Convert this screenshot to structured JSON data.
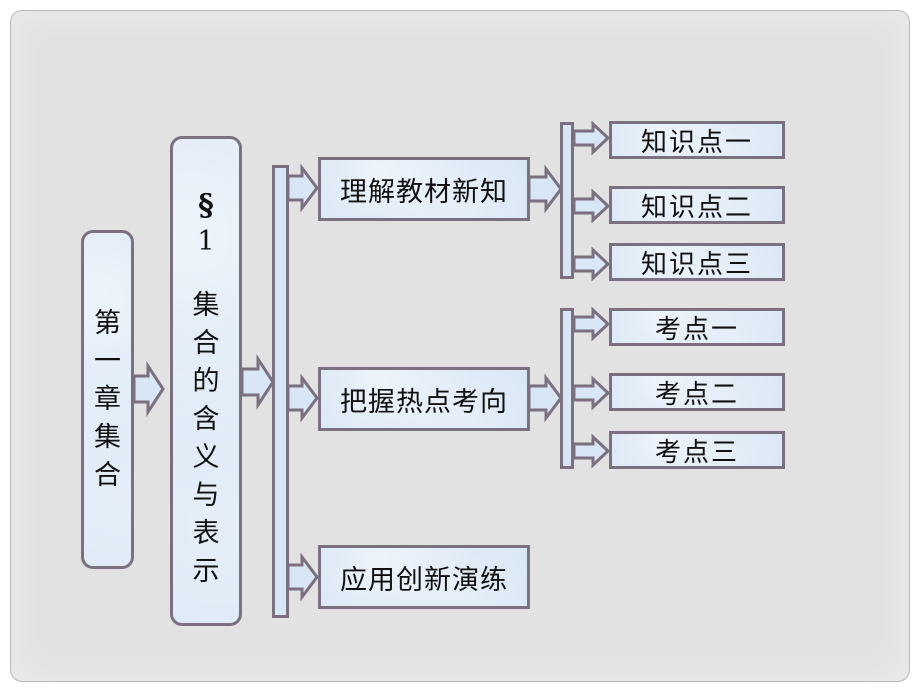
{
  "diagram": {
    "chapter": {
      "label": "第一章集合",
      "chars": [
        "第",
        "一",
        "章",
        "集",
        "合"
      ]
    },
    "section": {
      "symbol": "§",
      "number": "1",
      "title": "集合的含义与表示",
      "chars": [
        "集",
        "合",
        "的",
        "含",
        "义",
        "与",
        "表",
        "示"
      ]
    },
    "branches": [
      {
        "label": "理解教材新知",
        "children": [
          "知识点一",
          "知识点二",
          "知识点三"
        ]
      },
      {
        "label": "把握热点考向",
        "children": [
          "考点一",
          "考点二",
          "考点三"
        ]
      },
      {
        "label": "应用创新演练",
        "children": []
      }
    ]
  },
  "colors": {
    "box_fill": "#d8e6f5",
    "box_border": "#7a7080",
    "panel_bg": "#e2e2e2"
  }
}
